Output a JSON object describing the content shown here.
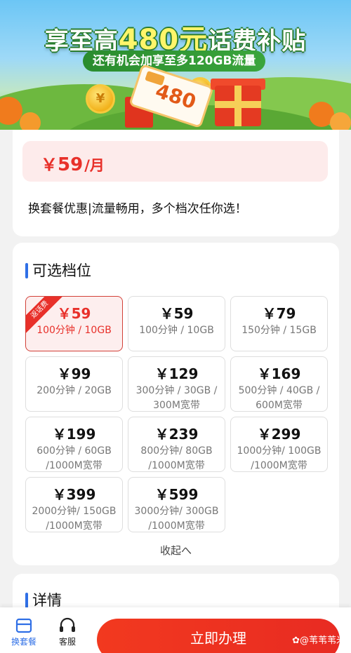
{
  "banner": {
    "title_pre": "享至高",
    "title_amount": "480元",
    "title_post": "话费补贴",
    "subtitle": "还有机会加享至多120GB流量",
    "ticket_amount": "480",
    "coin_glyph": "¥"
  },
  "plan": {
    "yen": "￥",
    "price": "59",
    "unit": "/月",
    "promo": "换套餐优惠|流量畅用，多个档次任你选！"
  },
  "tiers": {
    "title": "可选档位",
    "collapse_label": "收起へ",
    "badge": "返话费",
    "options": [
      {
        "price": "￥59",
        "line1": "100分钟 / 10GB",
        "line2": "",
        "selected": true
      },
      {
        "price": "￥59",
        "line1": "100分钟 / 10GB",
        "line2": "",
        "selected": false
      },
      {
        "price": "￥79",
        "line1": "150分钟 / 15GB",
        "line2": "",
        "selected": false
      },
      {
        "price": "￥99",
        "line1": "200分钟 / 20GB",
        "line2": "",
        "selected": false
      },
      {
        "price": "￥129",
        "line1": "300分钟 / 30GB /",
        "line2": "300M宽带",
        "selected": false
      },
      {
        "price": "￥169",
        "line1": "500分钟 / 40GB /",
        "line2": "600M宽带",
        "selected": false
      },
      {
        "price": "￥199",
        "line1": "600分钟 / 60GB",
        "line2": "/1000M宽带",
        "selected": false
      },
      {
        "price": "￥239",
        "line1": "800分钟/ 80GB",
        "line2": "/1000M宽带",
        "selected": false
      },
      {
        "price": "￥299",
        "line1": "1000分钟/ 100GB",
        "line2": "/1000M宽带",
        "selected": false
      },
      {
        "price": "￥399",
        "line1": "2000分钟/ 150GB",
        "line2": "/1000M宽带",
        "selected": false
      },
      {
        "price": "￥599",
        "line1": "3000分钟/ 300GB",
        "line2": "/1000M宽带",
        "selected": false
      }
    ]
  },
  "details": {
    "title": "详情"
  },
  "bottom": {
    "nav_exchange": "换套餐",
    "nav_service": "客服",
    "cta": "立即办理",
    "watermark": "✿@苇苇苇米"
  },
  "colors": {
    "accent_red": "#e8302a",
    "accent_blue": "#2f6fe6",
    "selected_bg": "#fdeeee"
  }
}
